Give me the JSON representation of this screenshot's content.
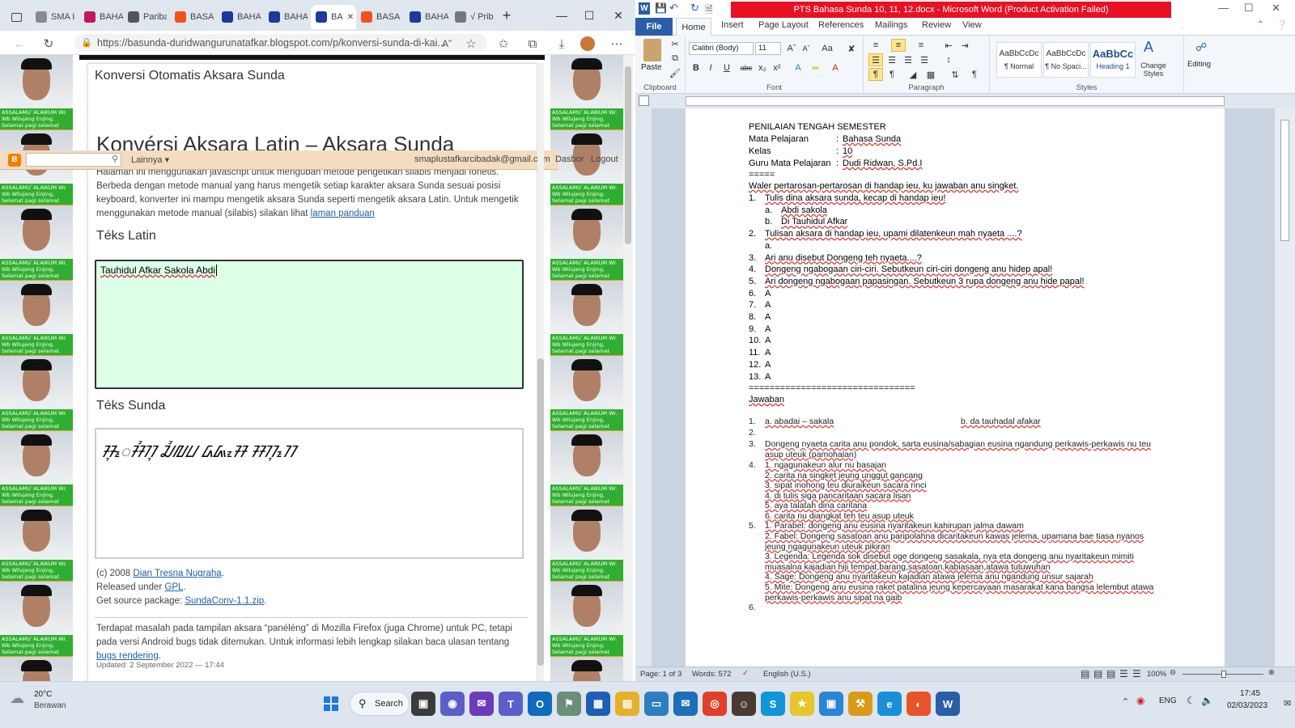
{
  "browser": {
    "tabs": [
      {
        "label": "SMA I",
        "color": "#8a8a8a"
      },
      {
        "label": "BAHA",
        "color": "#c2185b"
      },
      {
        "label": "Pariba",
        "color": "#555555"
      },
      {
        "label": "BASA",
        "color": "#f4511e"
      },
      {
        "label": "BAHA",
        "color": "#1a3a9c"
      },
      {
        "label": "BAHA",
        "color": "#1a3a9c"
      },
      {
        "label": "BA",
        "color": "#1a3a9c"
      },
      {
        "label": "BASA",
        "color": "#f4511e"
      },
      {
        "label": "BAHA",
        "color": "#1a3a9c"
      },
      {
        "label": "√ Prib",
        "color": "#777777"
      }
    ],
    "url": "https://basunda-duridwangurunatafkar.blogspot.com/p/konversi-sunda-di-kai...",
    "blogger_bar": {
      "more": "Lainnya ▾",
      "email": "smaplustafkarcibadak@gmail.com",
      "dashboard": "Dasbor",
      "logout": "Logout"
    },
    "page": {
      "header": "Konversi Otomatis Aksara Sunda",
      "title": "Konvérsi Aksara Latin – Aksara Sunda",
      "intro": "Halaman ini menggunakan javascript untuk mengubah metode pengetikan silabis menjadi fonetis. Berbeda dengan metode manual yang harus mengetik setiap karakter aksara Sunda sesuai posisi keyboard, konverter ini mampu mengetik aksara Sunda seperti mengetik aksara Latin. Untuk mengetik menggunakan metode manual (silabis) silakan lihat",
      "intro_link": "laman panduan",
      "latin_heading": "Téks Latin",
      "latin_value": "Tauhidul Afkar Sakola Abdi",
      "sunda_heading": "Téks Sunda",
      "sunda_value": "ᮞᮥᮦᮞᮤᮊᮥ ᮎᮤᮜᮗ ᮓᮏᮧᮞ ᮞᮊᮥᮊᮦ",
      "copyright": "(c) 2008",
      "author": "Dian Tresna Nugraha",
      "released": "Released under",
      "license": "GPL",
      "source": "Get source package:",
      "source_link": "SundaConv-1.1.zip",
      "note": "Terdapat masalah pada tampilan aksara “panéléng” di Mozilla Firefox (juga Chrome) untuk PC, tetapi pada versi Android bugs tidak ditemukan. Untuk informasi lebih lengkap silakan baca ulasan tentang",
      "note_link": "bugs rendering",
      "updated": "Updated: 2 September 2022 — 17:44"
    },
    "thumb_caption": "ASSALAMU`ALAIKUM Wr. Wb Wilujeng Enjing, Selamat pagi selamat beraktivitas hari ini"
  },
  "word": {
    "title": "PTS Bahasa Sunda 10, 11, 12.docx - Microsoft Word (Product Activation Failed)",
    "tabs": {
      "file": "File",
      "home": "Home",
      "insert": "Insert",
      "page_layout": "Page Layout",
      "references": "References",
      "mailings": "Mailings",
      "review": "Review",
      "view": "View"
    },
    "ribbon": {
      "paste": "Paste",
      "clipboard": "Clipboard",
      "font_name": "Calibri (Body)",
      "font_size": "11",
      "font": "Font",
      "paragraph": "Paragraph",
      "styles": "Styles",
      "style_normal_preview": "AaBbCcDc",
      "style_normal": "¶ Normal",
      "style_nospacing_preview": "AaBbCcDc",
      "style_nospacing": "¶ No Spaci...",
      "style_heading_preview": "AaBbCc",
      "style_heading": "Heading 1",
      "change_styles": "Change Styles",
      "editing": "Editing"
    },
    "doc": {
      "heading": "PENILAIAN TENGAH SEMESTER",
      "meta": [
        {
          "label": "Mata Pelajaran",
          "value": "Bahasa Sunda"
        },
        {
          "label": "Kelas",
          "value": "10"
        },
        {
          "label": "Guru Mata Pelajaran",
          "value": "Dudi Ridwan, S.Pd.I"
        }
      ],
      "sep1": "=====",
      "instruction": "Waler pertarosan-pertarosan di handap ieu, ku jawaban anu singket.",
      "questions": [
        {
          "n": "1.",
          "text": "Tulis dina aksara sunda, kecap di handap ieu!"
        },
        {
          "n": "a.",
          "text": "Abdi sakola",
          "sub": true
        },
        {
          "n": "b.",
          "text": "Di Tauhidul Afkar",
          "sub": true
        },
        {
          "n": "2.",
          "text": "Tulisan aksara di handap ieu, upami dilatenkeun mah nyaeta ....?"
        },
        {
          "n": "a.",
          "text": "",
          "sub": true
        },
        {
          "n": "3.",
          "text": "Ari anu disebut Dongeng teh nyaeta....?"
        },
        {
          "n": "4.",
          "text": "Dongeng ngabogaan ciri-ciri. Sebutkeun ciri-ciri dongeng anu hidep apal!"
        },
        {
          "n": "5.",
          "text": "Ari dongeng ngabogaan papasingan. Sebutkeun 3 rupa dongeng anu hide papal!"
        },
        {
          "n": "6.",
          "text": "A"
        },
        {
          "n": "7.",
          "text": "A"
        },
        {
          "n": "8.",
          "text": "A"
        },
        {
          "n": "9.",
          "text": "A"
        },
        {
          "n": "10.",
          "text": "A"
        },
        {
          "n": "11.",
          "text": "A"
        },
        {
          "n": "12.",
          "text": "A"
        },
        {
          "n": "13.",
          "text": "A"
        }
      ],
      "sep2": "================================",
      "answers_title": "Jawaban",
      "a1_left": "a. abadai – sakala",
      "a1_right": "b. da tauhadal afakar",
      "a3": "Dongeng nyaeta carita anu pondok, sarta eusina/sabagian eusina ngandung perkawis-perkawis nu teu asup uteuk (pamohalan)",
      "a4": [
        "1. ngagunakeun alur nu basajan",
        "2. carita na singket jeung unggut gancang",
        "3. sipat inohong teu diuraikeun sacara rinci",
        "4. di tulis siga pancaritaan sacara lisan",
        "5. aya talatah dina caritana",
        "6. carita nu diangkat teh teu asup uteuk"
      ],
      "a5": [
        "1. Parabel: dongeng anu eusina nyaritakeun kahirupan jalma dawam",
        "2. Fabel: Dongeng sasatoan anu paripolahna dicaritakeun kawas jelema, upamana bae tiasa nyanos jeung ngagunakeun uteuk pikiran",
        "3. Legenda: Legenda sok disebut oge dongeng sasakala, nya eta dongeng anu nyaritakeun mimiti muasalna kajadian hiji tempat,barang,sasatoan,kabiasaan,atawa tutuwuhan",
        "4. Sage: Dongeng anu nyaritakeun kajadian atawa jelema anu ngandung unsur sajarah",
        "5. Mite: Dongeng anu eusina raket patalina jeung kepercayaan masarakat kana bangsa lelembut atawa perkawis-perkawis anu sipat na gaib"
      ]
    },
    "status": {
      "page": "Page: 1 of 3",
      "words": "Words: 572",
      "lang": "English (U.S.)",
      "zoom": "100%"
    }
  },
  "taskbar": {
    "temp": "20°C",
    "weather": "Berawan",
    "search": "Search",
    "lang": "ENG",
    "time": "17:45",
    "date": "02/03/2023"
  }
}
